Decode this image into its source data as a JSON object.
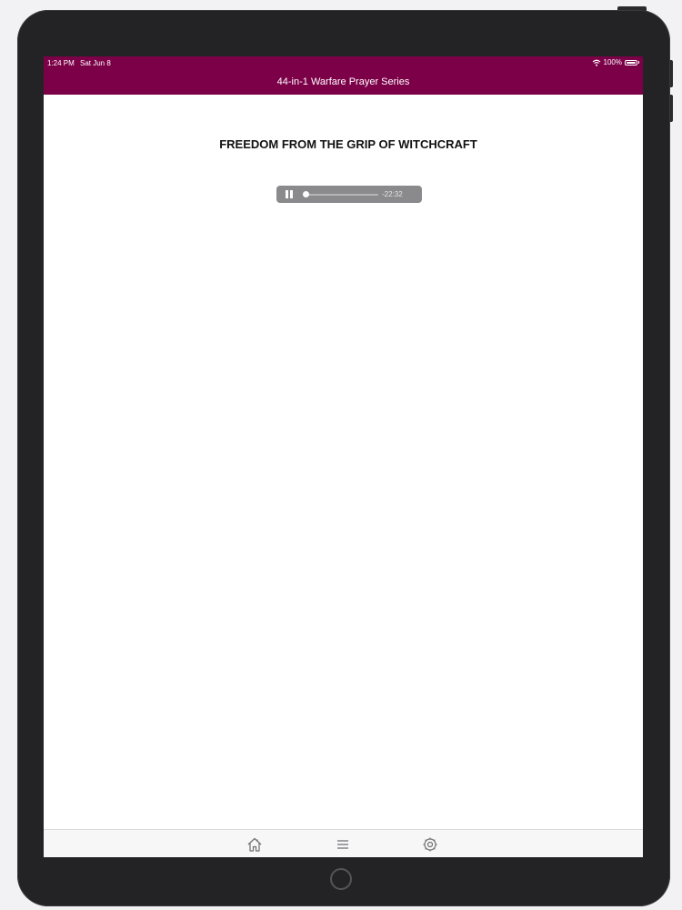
{
  "status_bar": {
    "time": "1:24 PM",
    "date": "Sat Jun 8",
    "battery": "100%",
    "icons": [
      "wifi-icon",
      "battery-icon"
    ]
  },
  "nav_bar": {
    "title": "44-in-1 Warfare Prayer Series"
  },
  "content": {
    "title": "FREEDOM FROM THE GRIP OF WITCHCRAFT"
  },
  "audio_player": {
    "state": "playing",
    "remaining_time": "-22:32",
    "progress": 0.02
  },
  "tab_bar": {
    "tabs": [
      {
        "icon": "home-icon"
      },
      {
        "icon": "menu-icon"
      },
      {
        "icon": "gear-icon"
      }
    ]
  },
  "colors": {
    "accent": "#7c0048",
    "device_bezel": "#232325",
    "player_background": "#8a8a8c"
  }
}
